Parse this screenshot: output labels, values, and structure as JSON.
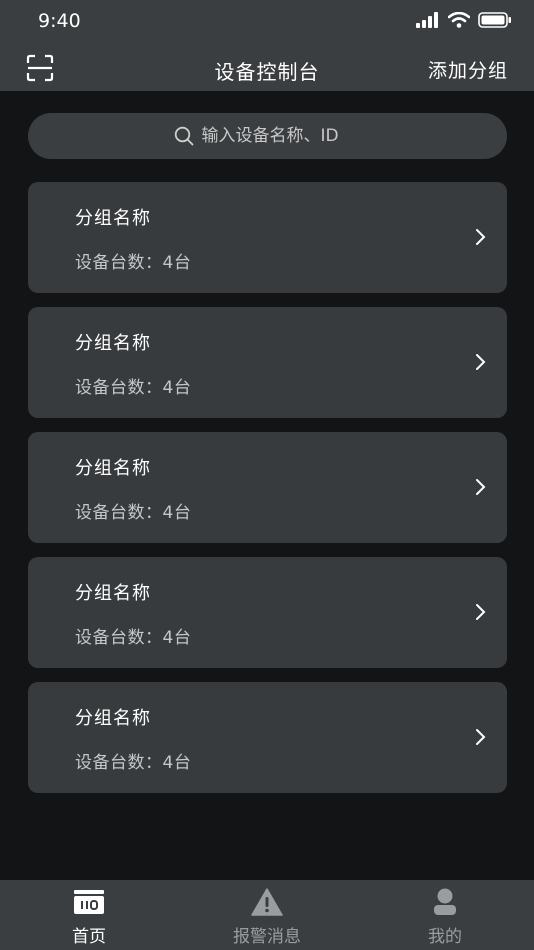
{
  "status_bar": {
    "time": "9:40",
    "icons": [
      "signal-icon",
      "wifi-icon",
      "battery-icon"
    ]
  },
  "nav": {
    "title": "设备控制台",
    "left_icon": "scan-icon",
    "right_action": "添加分组"
  },
  "search": {
    "icon": "search-icon",
    "placeholder": "输入设备名称、ID",
    "value": ""
  },
  "groups": [
    {
      "name": "分组名称",
      "count_label": "设备台数：",
      "count_value": "4台"
    },
    {
      "name": "分组名称",
      "count_label": "设备台数：",
      "count_value": "4台"
    },
    {
      "name": "分组名称",
      "count_label": "设备台数：",
      "count_value": "4台"
    },
    {
      "name": "分组名称",
      "count_label": "设备台数：",
      "count_value": "4台"
    },
    {
      "name": "分组名称",
      "count_label": "设备台数：",
      "count_value": "4台"
    }
  ],
  "tabs": [
    {
      "label": "首页",
      "icon": "home-device-icon",
      "active": true
    },
    {
      "label": "报警消息",
      "icon": "alarm-warning-icon",
      "active": false
    },
    {
      "label": "我的",
      "icon": "user-icon",
      "active": false
    }
  ],
  "colors": {
    "background": "#131416",
    "bar": "#3a3e41",
    "card": "#373b3e",
    "text_primary": "#ffffff",
    "text_secondary": "#c5c7c9",
    "tab_inactive": "#9a9da0"
  }
}
